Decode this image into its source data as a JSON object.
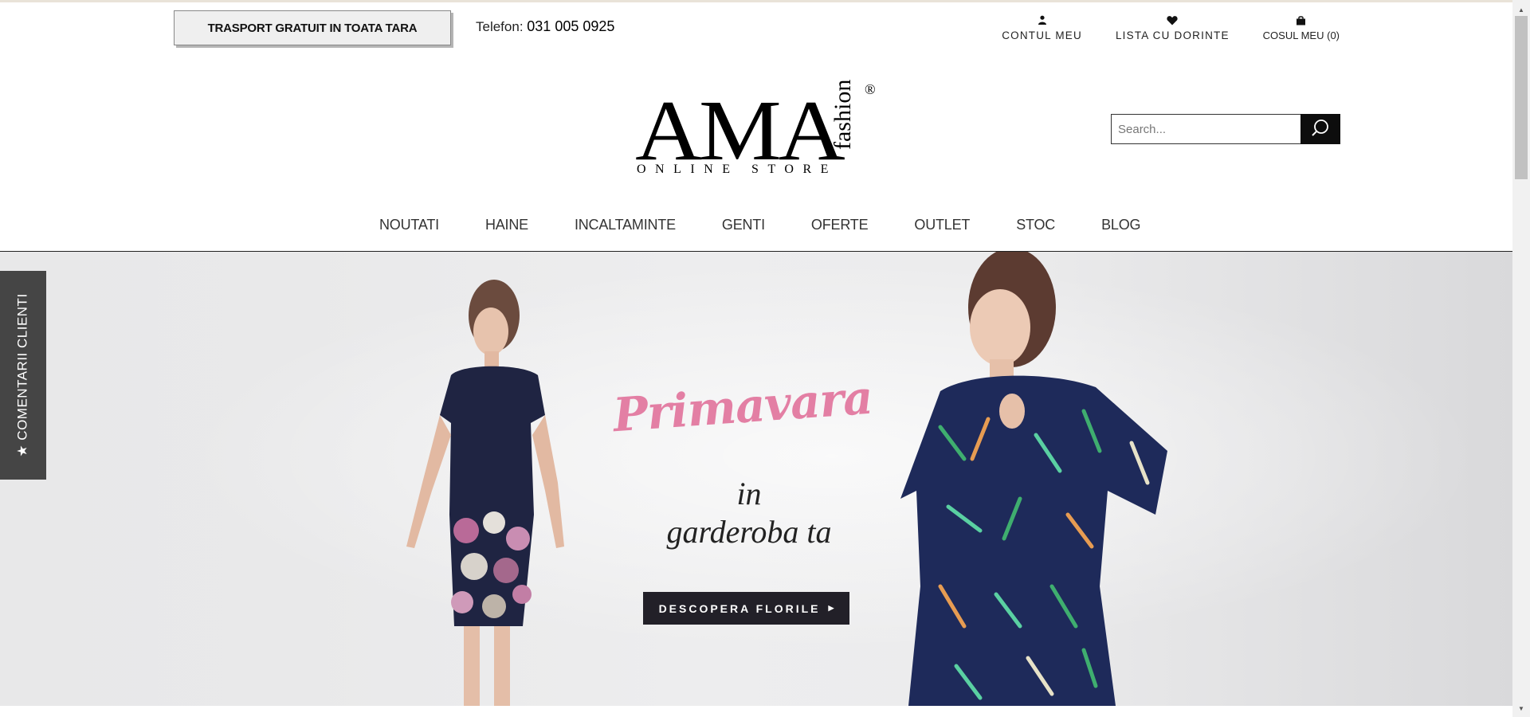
{
  "topbar": {
    "shipping_label": "TRASPORT GRATUIT IN TOATA TARA",
    "phone_label": "Telefon:",
    "phone_number": "031 005 0925"
  },
  "account": {
    "my_account": "CONTUL MEU",
    "wishlist": "LISTA CU DORINTE",
    "cart": "COSUL MEU",
    "cart_count": "(0)"
  },
  "logo": {
    "brand": "AMA",
    "tagline": "fashion",
    "subtitle": "ONLINE STORE",
    "registered": "®"
  },
  "search": {
    "placeholder": "Search..."
  },
  "nav": {
    "items": [
      "NOUTATI",
      "HAINE",
      "INCALTAMINTE",
      "GENTI",
      "OFERTE",
      "OUTLET",
      "STOC",
      "BLOG"
    ]
  },
  "banner": {
    "headline": "Primavara",
    "line1": "in",
    "line2": "garderoba ta",
    "cta": "DESCOPERA FLORILE"
  },
  "side_tab": {
    "label": "★ COMENTARII CLIENTI"
  },
  "colors": {
    "accent_pink": "#e37fa4",
    "cta_bg": "#222028",
    "side_tab_bg": "#454545"
  }
}
